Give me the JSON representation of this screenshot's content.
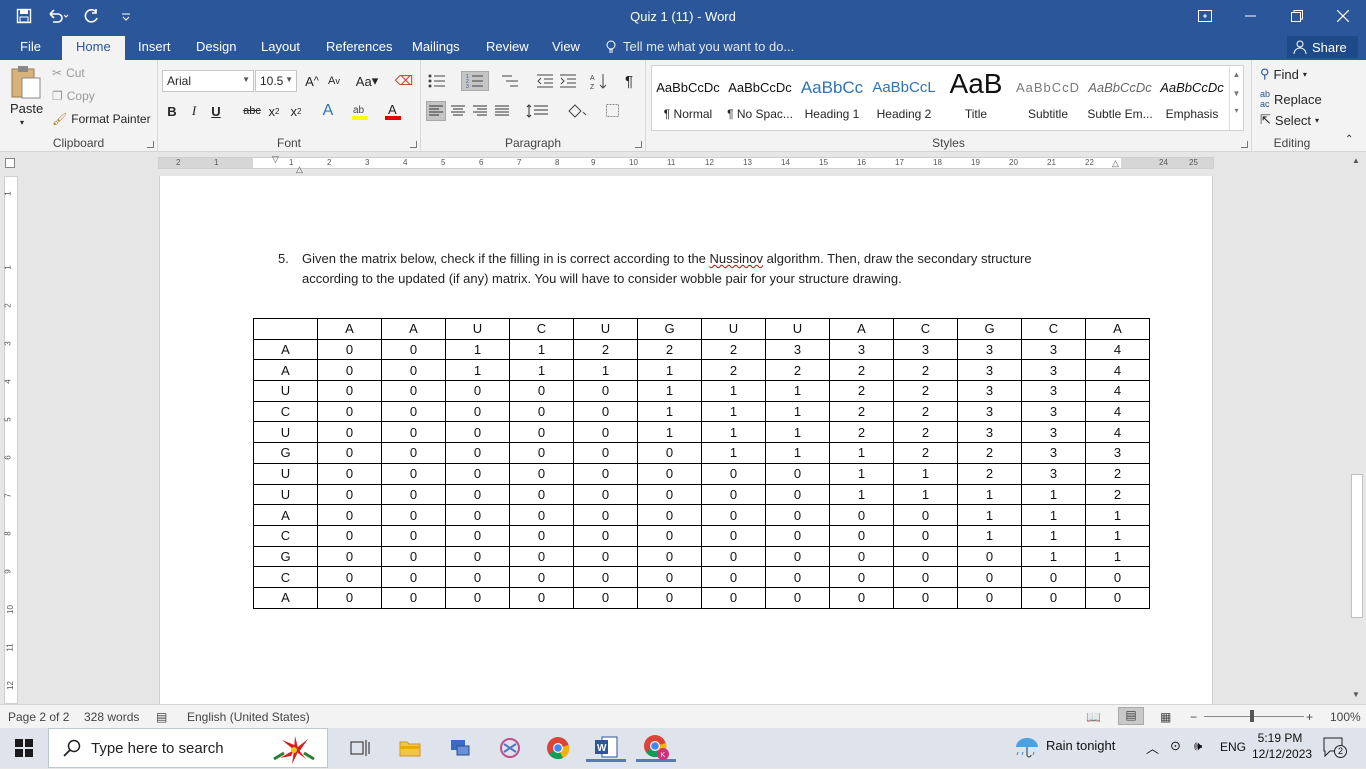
{
  "window": {
    "title": "Quiz 1 (11) - Word"
  },
  "tabs": [
    "File",
    "Home",
    "Insert",
    "Design",
    "Layout",
    "References",
    "Mailings",
    "Review",
    "View"
  ],
  "tell_me": "Tell me what you want to do...",
  "share_label": "Share",
  "clipboard": {
    "paste": "Paste",
    "cut": "Cut",
    "copy": "Copy",
    "format_painter": "Format Painter",
    "label": "Clipboard"
  },
  "font": {
    "name": "Arial",
    "size": "10.5",
    "label": "Font",
    "grow": "A",
    "shrink": "A",
    "case": "Aa",
    "bold": "B",
    "italic": "I",
    "underline": "U",
    "strike": "abc",
    "sub": "x",
    "sup": "x"
  },
  "paragraph": {
    "label": "Paragraph",
    "pilcrow": "¶"
  },
  "styles": {
    "label": "Styles",
    "items": [
      {
        "preview": "AaBbCcDc",
        "name": "¶ Normal"
      },
      {
        "preview": "AaBbCcDc",
        "name": "¶ No Spac..."
      },
      {
        "preview": "AaBbCc",
        "name": "Heading 1"
      },
      {
        "preview": "AaBbCcL",
        "name": "Heading 2"
      },
      {
        "preview": "AaB",
        "name": "Title"
      },
      {
        "preview": "AaBbCcD",
        "name": "Subtitle"
      },
      {
        "preview": "AaBbCcDc",
        "name": "Subtle Em..."
      },
      {
        "preview": "AaBbCcDc",
        "name": "Emphasis"
      }
    ]
  },
  "editing": {
    "find": "Find",
    "replace": "Replace",
    "select": "Select",
    "label": "Editing"
  },
  "ruler_h": [
    "2",
    "1",
    "1",
    "2",
    "3",
    "4",
    "5",
    "6",
    "7",
    "8",
    "9",
    "10",
    "11",
    "12",
    "13",
    "14",
    "15",
    "16",
    "17",
    "18",
    "19",
    "20",
    "21",
    "22",
    "24",
    "25"
  ],
  "ruler_v": [
    "1",
    "1",
    "2",
    "3",
    "4",
    "5",
    "6",
    "7",
    "8",
    "9",
    "10",
    "11",
    "12"
  ],
  "document": {
    "q_number": "5.",
    "q_text_a": "Given the matrix below, check if the filling in is correct according to the ",
    "q_text_name": "Nussinov",
    "q_text_b": " algorithm. Then, draw the secondary structure according to the updated (if any) matrix. You will have to consider wobble pair for your structure drawing.",
    "matrix": {
      "header": [
        "",
        "A",
        "A",
        "U",
        "C",
        "U",
        "G",
        "U",
        "U",
        "A",
        "C",
        "G",
        "C",
        "A"
      ],
      "rows": [
        [
          "A",
          "0",
          "0",
          "1",
          "1",
          "2",
          "2",
          "2",
          "3",
          "3",
          "3",
          "3",
          "3",
          "4"
        ],
        [
          "A",
          "0",
          "0",
          "1",
          "1",
          "1",
          "1",
          "2",
          "2",
          "2",
          "2",
          "3",
          "3",
          "4"
        ],
        [
          "U",
          "0",
          "0",
          "0",
          "0",
          "0",
          "1",
          "1",
          "1",
          "2",
          "2",
          "3",
          "3",
          "4"
        ],
        [
          "C",
          "0",
          "0",
          "0",
          "0",
          "0",
          "1",
          "1",
          "1",
          "2",
          "2",
          "3",
          "3",
          "4"
        ],
        [
          "U",
          "0",
          "0",
          "0",
          "0",
          "0",
          "1",
          "1",
          "1",
          "2",
          "2",
          "3",
          "3",
          "4"
        ],
        [
          "G",
          "0",
          "0",
          "0",
          "0",
          "0",
          "0",
          "1",
          "1",
          "1",
          "2",
          "2",
          "3",
          "3"
        ],
        [
          "U",
          "0",
          "0",
          "0",
          "0",
          "0",
          "0",
          "0",
          "0",
          "1",
          "1",
          "2",
          "3",
          "2"
        ],
        [
          "U",
          "0",
          "0",
          "0",
          "0",
          "0",
          "0",
          "0",
          "0",
          "1",
          "1",
          "1",
          "1",
          "2"
        ],
        [
          "A",
          "0",
          "0",
          "0",
          "0",
          "0",
          "0",
          "0",
          "0",
          "0",
          "0",
          "1",
          "1",
          "1"
        ],
        [
          "C",
          "0",
          "0",
          "0",
          "0",
          "0",
          "0",
          "0",
          "0",
          "0",
          "0",
          "1",
          "1",
          "1"
        ],
        [
          "G",
          "0",
          "0",
          "0",
          "0",
          "0",
          "0",
          "0",
          "0",
          "0",
          "0",
          "0",
          "1",
          "1"
        ],
        [
          "C",
          "0",
          "0",
          "0",
          "0",
          "0",
          "0",
          "0",
          "0",
          "0",
          "0",
          "0",
          "0",
          "0"
        ],
        [
          "A",
          "0",
          "0",
          "0",
          "0",
          "0",
          "0",
          "0",
          "0",
          "0",
          "0",
          "0",
          "0",
          "0"
        ]
      ]
    }
  },
  "status": {
    "page": "Page 2 of 2",
    "words": "328 words",
    "language": "English (United States)",
    "zoom": "100%"
  },
  "taskbar": {
    "search_placeholder": "Type here to search",
    "weather": "Rain tonight",
    "lang": "ENG",
    "time": "5:19 PM",
    "date": "12/12/2023",
    "notif_count": "2"
  },
  "colors": {
    "accent": "#2b579a",
    "ribbon": "#f3f3f3"
  }
}
